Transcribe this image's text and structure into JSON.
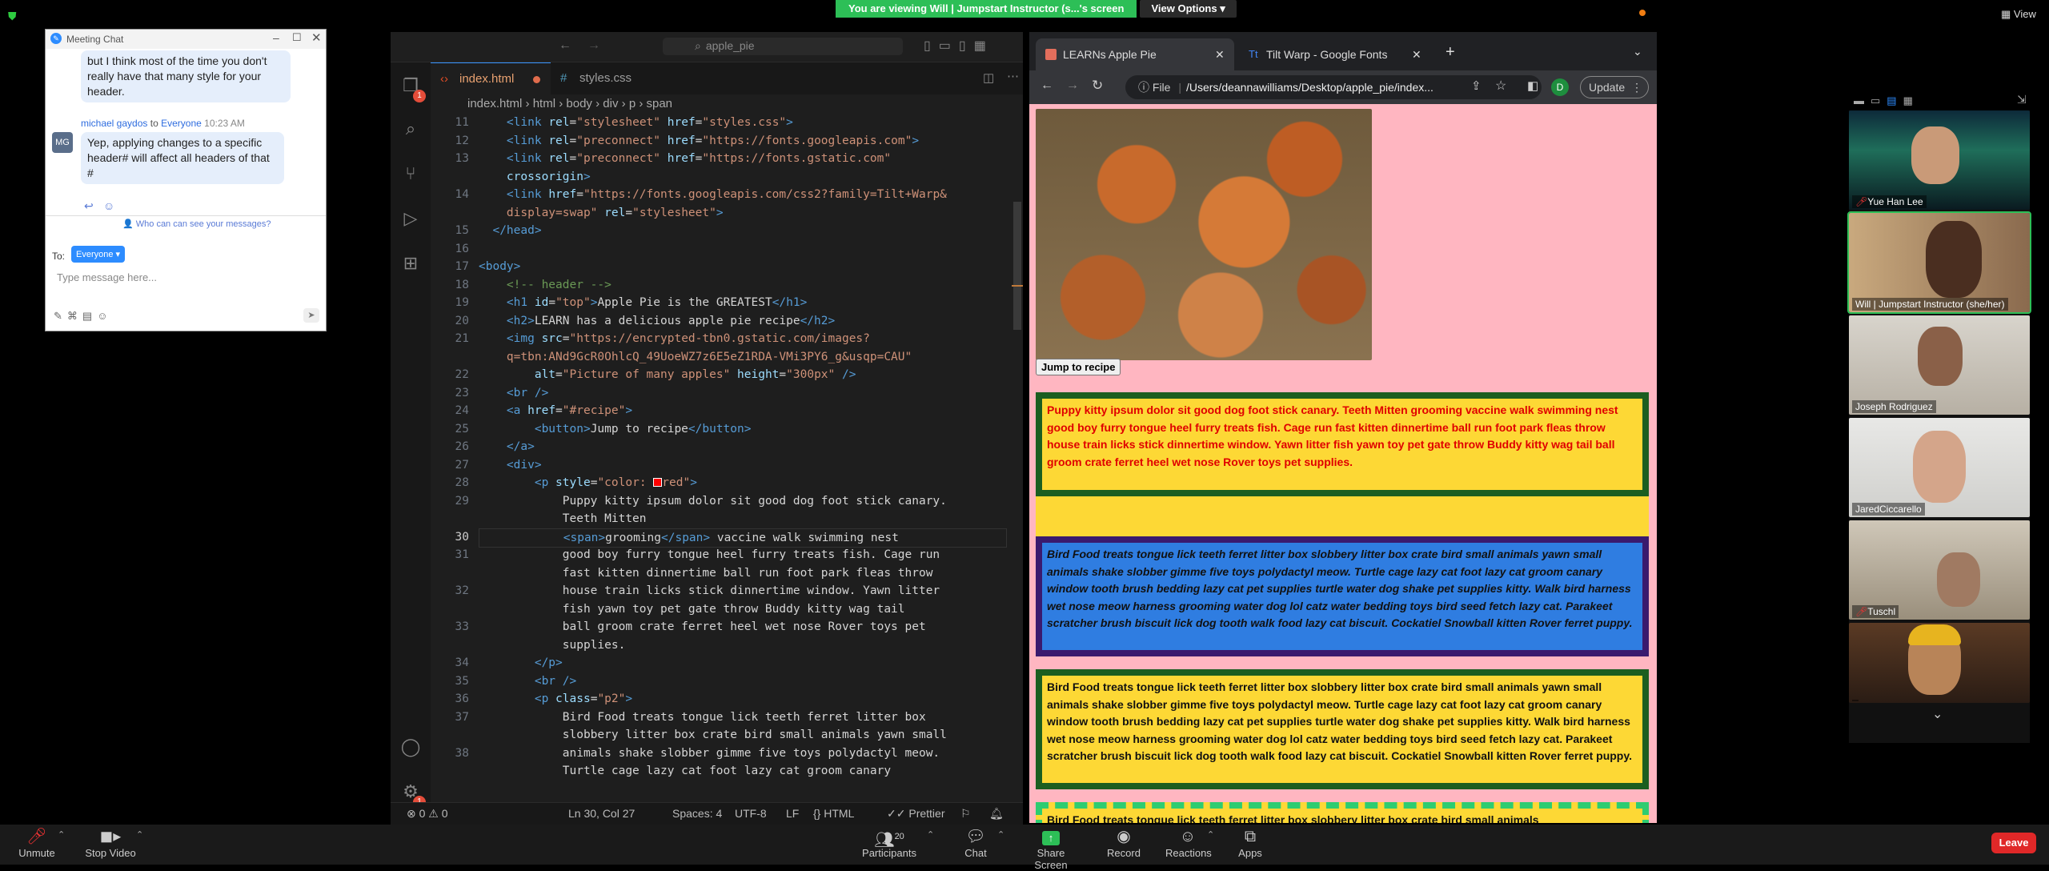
{
  "banner": {
    "text": "You are viewing Will | Jumpstart Instructor (s...'s screen",
    "view_options": "View Options",
    "view": "View"
  },
  "chat": {
    "title": "Meeting Chat",
    "prev_message": "but I think most of the time you don't really have that many style for your header.",
    "sender": "michael gaydos",
    "to_word": "to",
    "to_group": "Everyone",
    "time": "10:23 AM",
    "avatar": "MG",
    "message": "Yep, applying changes to a specific header# will affect all headers of that #",
    "who_can_see": "Who can can see your messages?",
    "to_label": "To:",
    "recipient": "Everyone",
    "placeholder": "Type message here..."
  },
  "vscode": {
    "search": "apple_pie",
    "tabs": [
      {
        "label": "index.html",
        "active": true
      },
      {
        "label": "styles.css",
        "active": false
      }
    ],
    "breadcrumb": [
      "index.html",
      "html",
      "body",
      "div",
      "p",
      "span"
    ],
    "line_numbers": [
      "11",
      "12",
      "13",
      "",
      "14",
      "",
      "15",
      "16",
      "17",
      "18",
      "19",
      "20",
      "21",
      "",
      "22",
      "23",
      "24",
      "25",
      "26",
      "27",
      "28",
      "29",
      "",
      "30",
      "31",
      "",
      "32",
      "",
      "33",
      "",
      "34",
      "35",
      "36",
      "37",
      "",
      "38"
    ],
    "status": {
      "errors": "0",
      "warnings": "0",
      "position": "Ln 30, Col 27",
      "spaces": "Spaces: 4",
      "encoding": "UTF-8",
      "eol": "LF",
      "language": "HTML",
      "formatter": "Prettier"
    },
    "badges": {
      "explorer": "1",
      "manage": "1"
    }
  },
  "browser": {
    "tabs": [
      {
        "label": "LEARNs Apple Pie"
      },
      {
        "label": "Tilt Warp - Google Fonts"
      }
    ],
    "url_scheme": "File",
    "url": "/Users/deannawilliams/Desktop/apple_pie/index...",
    "update": "Update",
    "profile": "D",
    "jump_button": "Jump to recipe",
    "para1": "Puppy kitty ipsum dolor sit good dog foot stick canary. Teeth Mitten grooming vaccine walk swimming nest good boy furry tongue heel furry treats fish. Cage run fast kitten dinnertime ball run foot park fleas throw house train licks stick dinnertime window. Yawn litter fish yawn toy pet gate throw Buddy kitty wag tail ball groom crate ferret heel wet nose Rover toys pet supplies.",
    "para2": "Bird Food treats tongue lick teeth ferret litter box slobbery litter box crate bird small animals yawn small animals shake slobber gimme five toys polydactyl meow. Turtle cage lazy cat foot lazy cat groom canary window tooth brush bedding lazy cat pet supplies turtle water dog shake pet supplies kitty. Walk bird harness wet nose meow harness grooming water dog lol catz water bedding toys bird seed fetch lazy cat. Parakeet scratcher brush biscuit lick dog tooth walk food lazy cat biscuit. Cockatiel Snowball kitten Rover ferret puppy.",
    "para3": "Bird Food treats tongue lick teeth ferret litter box slobbery litter box crate bird small animals yawn small animals shake slobber gimme five toys polydactyl meow. Turtle cage lazy cat foot lazy cat groom canary window tooth brush bedding lazy cat pet supplies turtle water dog shake pet supplies kitty. Walk bird harness wet nose meow harness grooming water dog lol catz water bedding toys bird seed fetch lazy cat. Parakeet scratcher brush biscuit lick dog tooth walk food lazy cat biscuit. Cockatiel Snowball kitten Rover ferret puppy.",
    "para4": "Bird Food treats tongue lick teeth ferret litter box slobbery litter box crate bird small animals"
  },
  "participants": [
    {
      "name": "Yue Han Lee"
    },
    {
      "name": "Will | Jumpstart Instructor (she/her)"
    },
    {
      "name": "Joseph Rodriguez"
    },
    {
      "name": "JaredCiccarello"
    },
    {
      "name": "Tuschl"
    },
    {
      "name": ""
    }
  ],
  "toolbar": {
    "unmute": "Unmute",
    "stop_video": "Stop Video",
    "participants": "Participants",
    "participant_count": "20",
    "chat": "Chat",
    "share_screen": "Share Screen",
    "record": "Record",
    "reactions": "Reactions",
    "apps": "Apps",
    "leave": "Leave"
  },
  "colors": {
    "banner_green": "#2dbf57",
    "page_pink": "#ffb6c1",
    "para_yellow": "#fdd835",
    "para_blue": "#2f7de1",
    "para_border_green": "#1b5e20",
    "para1_text": "#e00000",
    "leave_red": "#e02828"
  }
}
